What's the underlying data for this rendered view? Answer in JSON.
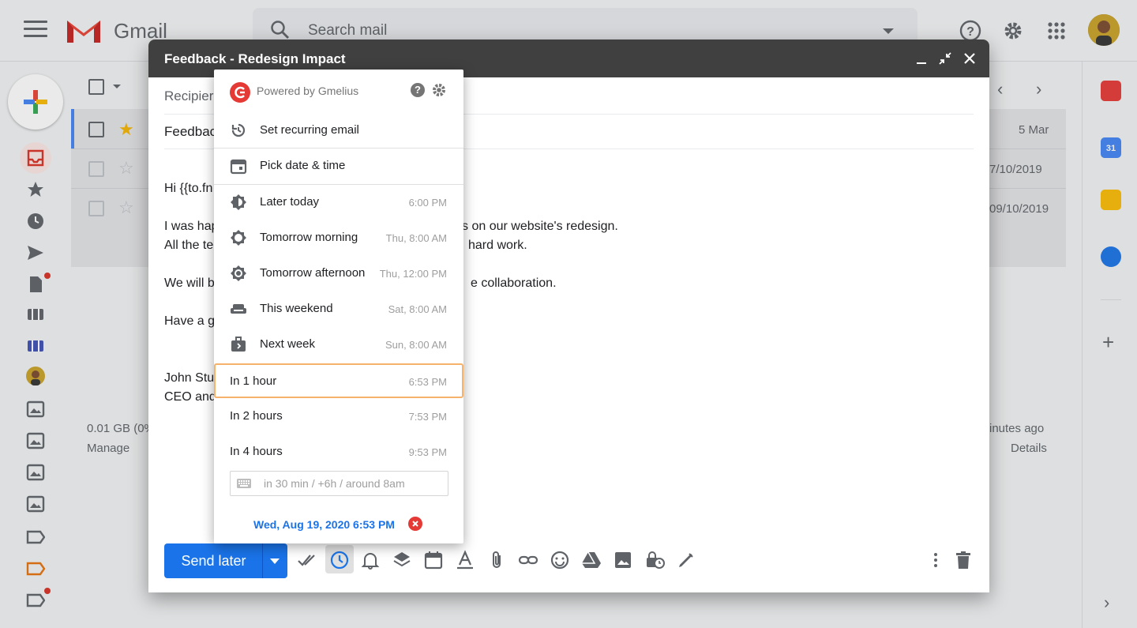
{
  "gmail": {
    "logo_text": "Gmail",
    "search_placeholder": "Search mail",
    "rows": [
      {
        "date": "5 Mar"
      },
      {
        "date": "7/10/2019"
      },
      {
        "date": "09/10/2019"
      }
    ],
    "footer": {
      "storage": "0.01 GB (0%",
      "manage": "Manage",
      "activity": "inutes ago",
      "details": "Details"
    }
  },
  "compose": {
    "title": "Feedback - Redesign Impact",
    "recipients_label": "Recipier",
    "subject_text": "Feedbac",
    "body_lines": [
      "Hi {{to.fn",
      "I was hap",
      "s on our website's redesign.",
      "All the te",
      "hard work.",
      "We will b",
      "e collaboration.",
      "Have a g",
      "John Stu",
      "CEO and"
    ],
    "send_label": "Send later"
  },
  "popup": {
    "powered_by": "Powered by Gmelius",
    "help_label": "?",
    "items": [
      {
        "label": "Set recurring email",
        "time": "",
        "icon": "recurring-icon"
      },
      {
        "label": "Pick date & time",
        "time": "",
        "icon": "calendar-icon"
      },
      {
        "label": "Later today",
        "time": "6:00 PM",
        "icon": "brightness-icon"
      },
      {
        "label": "Tomorrow morning",
        "time": "Thu, 8:00 AM",
        "icon": "sun-icon"
      },
      {
        "label": "Tomorrow afternoon",
        "time": "Thu, 12:00 PM",
        "icon": "sun-full-icon"
      },
      {
        "label": "This weekend",
        "time": "Sat, 8:00 AM",
        "icon": "couch-icon"
      },
      {
        "label": "Next week",
        "time": "Sun, 8:00 AM",
        "icon": "briefcase-icon"
      },
      {
        "label": "In 1 hour",
        "time": "6:53 PM",
        "icon": ""
      },
      {
        "label": "In 2 hours",
        "time": "7:53 PM",
        "icon": ""
      },
      {
        "label": "In 4 hours",
        "time": "9:53 PM",
        "icon": ""
      }
    ],
    "input_placeholder": "in 30 min / +6h / around 8am",
    "selected_date": "Wed, Aug 19, 2020 6:53 PM"
  },
  "colors": {
    "accent": "#1a73e8",
    "gmelius_red": "#e53935",
    "selected_border": "#f6b26b",
    "header_dark": "#404040"
  }
}
